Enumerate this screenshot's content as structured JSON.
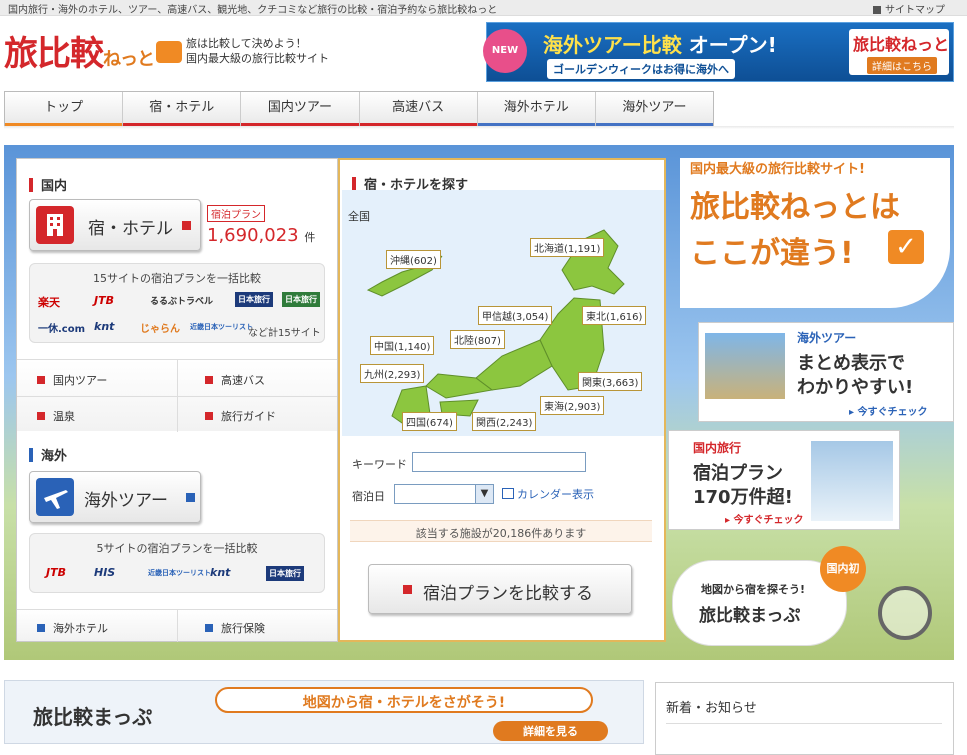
{
  "topbar": {
    "tagline": "国内旅行・海外のホテル、ツアー、高速バス、観光地、クチコミなど旅行の比較・宿泊予約なら旅比較ねっと",
    "sitemap": "サイトマップ"
  },
  "header": {
    "logo_main": "旅比較",
    "logo_sub": "ねっと",
    "tagline_1": "旅は比較して決めよう！",
    "tagline_2": "国内最大級の旅行比較サイト"
  },
  "top_banner": {
    "new": "NEW",
    "title_a": "海外ツアー比較",
    "title_b": "オープン!",
    "subtitle": "ゴールデンウィークはお得に海外へ",
    "logo": "旅比較ねっと",
    "detail": "詳細はこちら"
  },
  "nav": {
    "items": [
      "トップ",
      "宿・ホテル",
      "国内ツアー",
      "高速バス",
      "海外ホテル",
      "海外ツアー"
    ]
  },
  "domestic": {
    "heading": "国内",
    "hotel_button": "宿・ホテル",
    "plan_label": "宿泊プラン",
    "plan_count": "1,690,023",
    "plan_unit": "件",
    "compare_label": "15サイトの宿泊プランを一括比較",
    "logos": [
      "楽天",
      "JTB",
      "るるぶトラベル",
      "日本旅行",
      "日本旅行",
      "一休.com",
      "knt",
      "じゃらん",
      "近畿日本ツーリスト"
    ],
    "more": "など計15サイト",
    "links": [
      "国内ツアー",
      "高速バス",
      "温泉",
      "旅行ガイド"
    ]
  },
  "overseas": {
    "heading": "海外",
    "tour_button": "海外ツアー",
    "compare_label": "5サイトの宿泊プランを一括比較",
    "logos": [
      "JTB",
      "HIS",
      "近畿日本ツーリスト",
      "knt",
      "日本旅行"
    ],
    "links": [
      "海外ホテル",
      "旅行保険"
    ]
  },
  "search": {
    "heading": "宿・ホテルを探す",
    "all_japan": "全国",
    "regions": [
      "沖縄(602)",
      "北海道(1,191)",
      "甲信越(3,054)",
      "東北(1,616)",
      "北陸(807)",
      "中国(1,140)",
      "九州(2,293)",
      "関東(3,663)",
      "東海(2,903)",
      "四国(674)",
      "関西(2,243)"
    ],
    "keyword_label": "キーワード",
    "keyword_value": "",
    "date_label": "宿泊日",
    "date_value": "",
    "calendar": "カレンダー表示",
    "result_note": "該当する施設が20,186件あります",
    "compare_button": "宿泊プランを比較する"
  },
  "right": {
    "headline_small": "国内最大級の旅行比較サイト!",
    "headline_1": "旅比較ねっとは",
    "headline_2": "ここが違う!",
    "cardA_tag": "海外ツアー",
    "cardA_1": "まとめ表示で",
    "cardA_2": "わかりやすい!",
    "cardA_check": "今すぐチェック",
    "cardB_tag": "国内旅行",
    "cardB_1": "宿泊プラン",
    "cardB_2": "170万件超!",
    "cardB_check": "今すぐチェック",
    "map_badge": "国内初",
    "map_1": "地図から宿を探そう!",
    "map_2": "旅比較まっぷ"
  },
  "bottom": {
    "map_logo": "旅比較まっぷ",
    "map_text": "地図から宿・ホテルをさがそう!",
    "map_detail": "詳細を見る",
    "news_heading": "新着・お知らせ"
  },
  "colors": {
    "brand_red": "#d4272b",
    "brand_orange": "#f08a24",
    "map_green": "#8cc63f"
  }
}
